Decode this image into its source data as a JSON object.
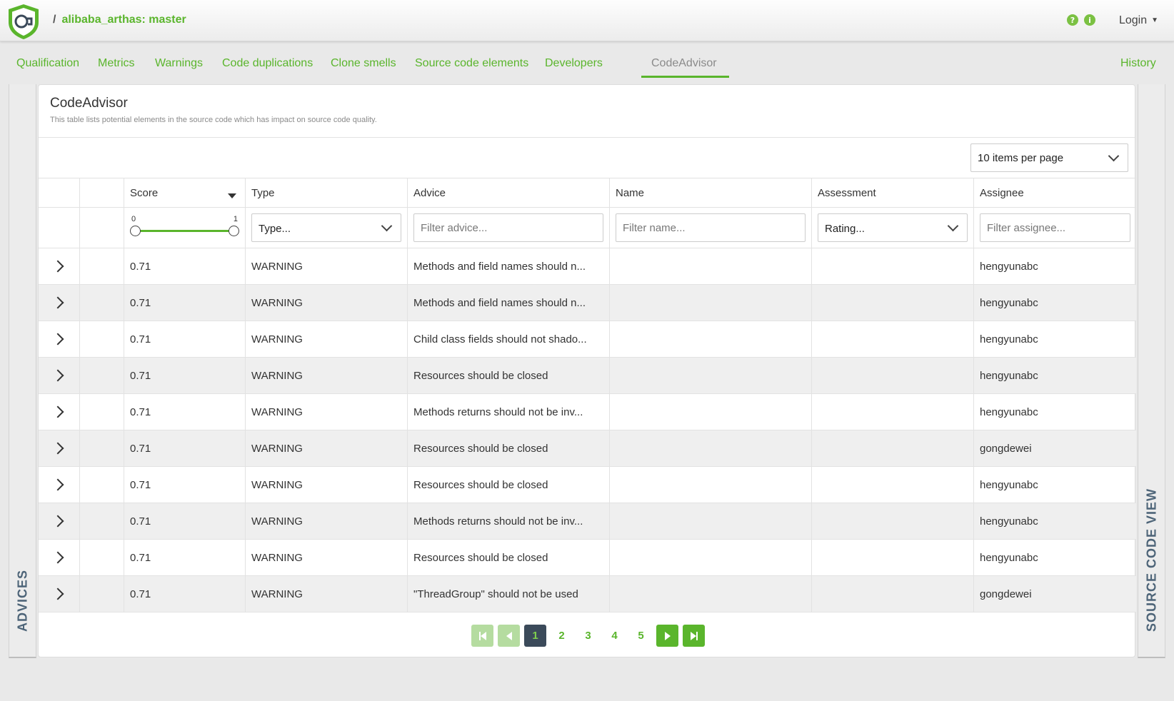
{
  "header": {
    "breadcrumb_sep": "/",
    "project": "alibaba_arthas: master",
    "help_icon": "question-circle-icon",
    "info_icon": "info-circle-icon",
    "help_glyph": "?",
    "info_glyph": "i",
    "login_label": "Login"
  },
  "nav": {
    "tabs": [
      "Qualification",
      "Metrics",
      "Warnings",
      "Code duplications",
      "Clone smells",
      "Source code elements",
      "Developers",
      "CodeAdvisor"
    ],
    "active_tab": "CodeAdvisor",
    "history_label": "History"
  },
  "side": {
    "left_label": "ADVICES",
    "right_label": "SOURCE CODE VIEW"
  },
  "panel": {
    "title": "CodeAdvisor",
    "subtitle": "This table lists potential elements in the source code which has impact on source code quality.",
    "per_page": "10 items per page"
  },
  "table": {
    "headers": {
      "score": "Score",
      "type": "Type",
      "advice": "Advice",
      "name": "Name",
      "assessment": "Assessment",
      "assignee": "Assignee"
    },
    "filters": {
      "score_min": "0",
      "score_max": "1",
      "type_placeholder": "Type...",
      "advice_placeholder": "Filter advice...",
      "name_placeholder": "Filter name...",
      "assessment_placeholder": "Rating...",
      "assignee_placeholder": "Filter assignee..."
    },
    "rows": [
      {
        "score": "0.71",
        "type": "WARNING",
        "advice": "Methods and field names should n...",
        "name": "",
        "assessment": "",
        "assignee": "hengyunabc"
      },
      {
        "score": "0.71",
        "type": "WARNING",
        "advice": "Methods and field names should n...",
        "name": "",
        "assessment": "",
        "assignee": "hengyunabc"
      },
      {
        "score": "0.71",
        "type": "WARNING",
        "advice": "Child class fields should not shado...",
        "name": "",
        "assessment": "",
        "assignee": "hengyunabc"
      },
      {
        "score": "0.71",
        "type": "WARNING",
        "advice": "Resources should be closed",
        "name": "",
        "assessment": "",
        "assignee": "hengyunabc"
      },
      {
        "score": "0.71",
        "type": "WARNING",
        "advice": "Methods returns should not be inv...",
        "name": "",
        "assessment": "",
        "assignee": "hengyunabc"
      },
      {
        "score": "0.71",
        "type": "WARNING",
        "advice": "Resources should be closed",
        "name": "",
        "assessment": "",
        "assignee": "gongdewei"
      },
      {
        "score": "0.71",
        "type": "WARNING",
        "advice": "Resources should be closed",
        "name": "",
        "assessment": "",
        "assignee": "hengyunabc"
      },
      {
        "score": "0.71",
        "type": "WARNING",
        "advice": "Methods returns should not be inv...",
        "name": "",
        "assessment": "",
        "assignee": "hengyunabc"
      },
      {
        "score": "0.71",
        "type": "WARNING",
        "advice": "Resources should be closed",
        "name": "",
        "assessment": "",
        "assignee": "hengyunabc"
      },
      {
        "score": "0.71",
        "type": "WARNING",
        "advice": "\"ThreadGroup\" should not be used",
        "name": "",
        "assessment": "",
        "assignee": "gongdewei"
      }
    ]
  },
  "pagination": {
    "pages": [
      "1",
      "2",
      "3",
      "4",
      "5"
    ],
    "current": "1"
  },
  "colors": {
    "accent": "#5ab52c",
    "current_page_bg": "#3b4a5a",
    "side_label": "#4d6478"
  }
}
